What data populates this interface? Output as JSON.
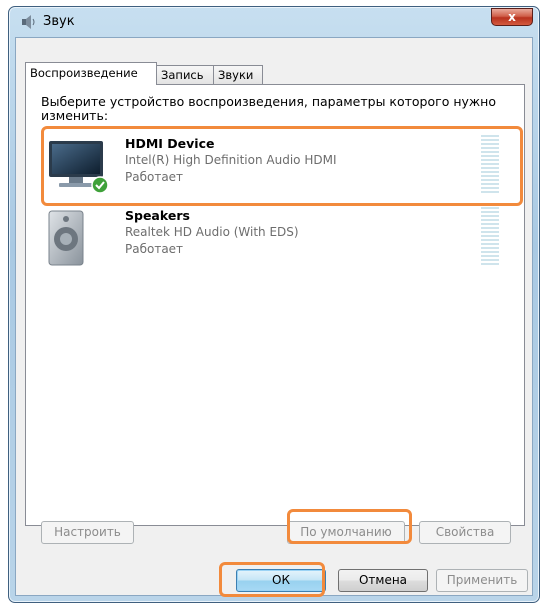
{
  "window": {
    "title": "Звук",
    "close_label": "x"
  },
  "tabs": [
    {
      "label": "Воспроизведение",
      "active": true
    },
    {
      "label": "Запись",
      "active": false
    },
    {
      "label": "Звуки",
      "active": false
    }
  ],
  "instruction": "Выберите устройство воспроизведения, параметры которого нужно изменить:",
  "devices": [
    {
      "name": "HDMI Device",
      "driver": "Intel(R) High Definition Audio HDMI",
      "status": "Работает",
      "icon": "monitor-icon",
      "selected": true,
      "is_default": true
    },
    {
      "name": "Speakers",
      "driver": "Realtek HD Audio (With EDS)",
      "status": "Работает",
      "icon": "speaker-icon",
      "selected": false,
      "is_default": false
    }
  ],
  "buttons": {
    "configure": "Настроить",
    "set_default": "По умолчанию",
    "properties": "Свойства",
    "ok": "ОК",
    "cancel": "Отмена",
    "apply": "Применить"
  },
  "colors": {
    "highlight": "#f28a3c",
    "titlebar": "#a9c9e3",
    "close_button": "#c8452c"
  }
}
